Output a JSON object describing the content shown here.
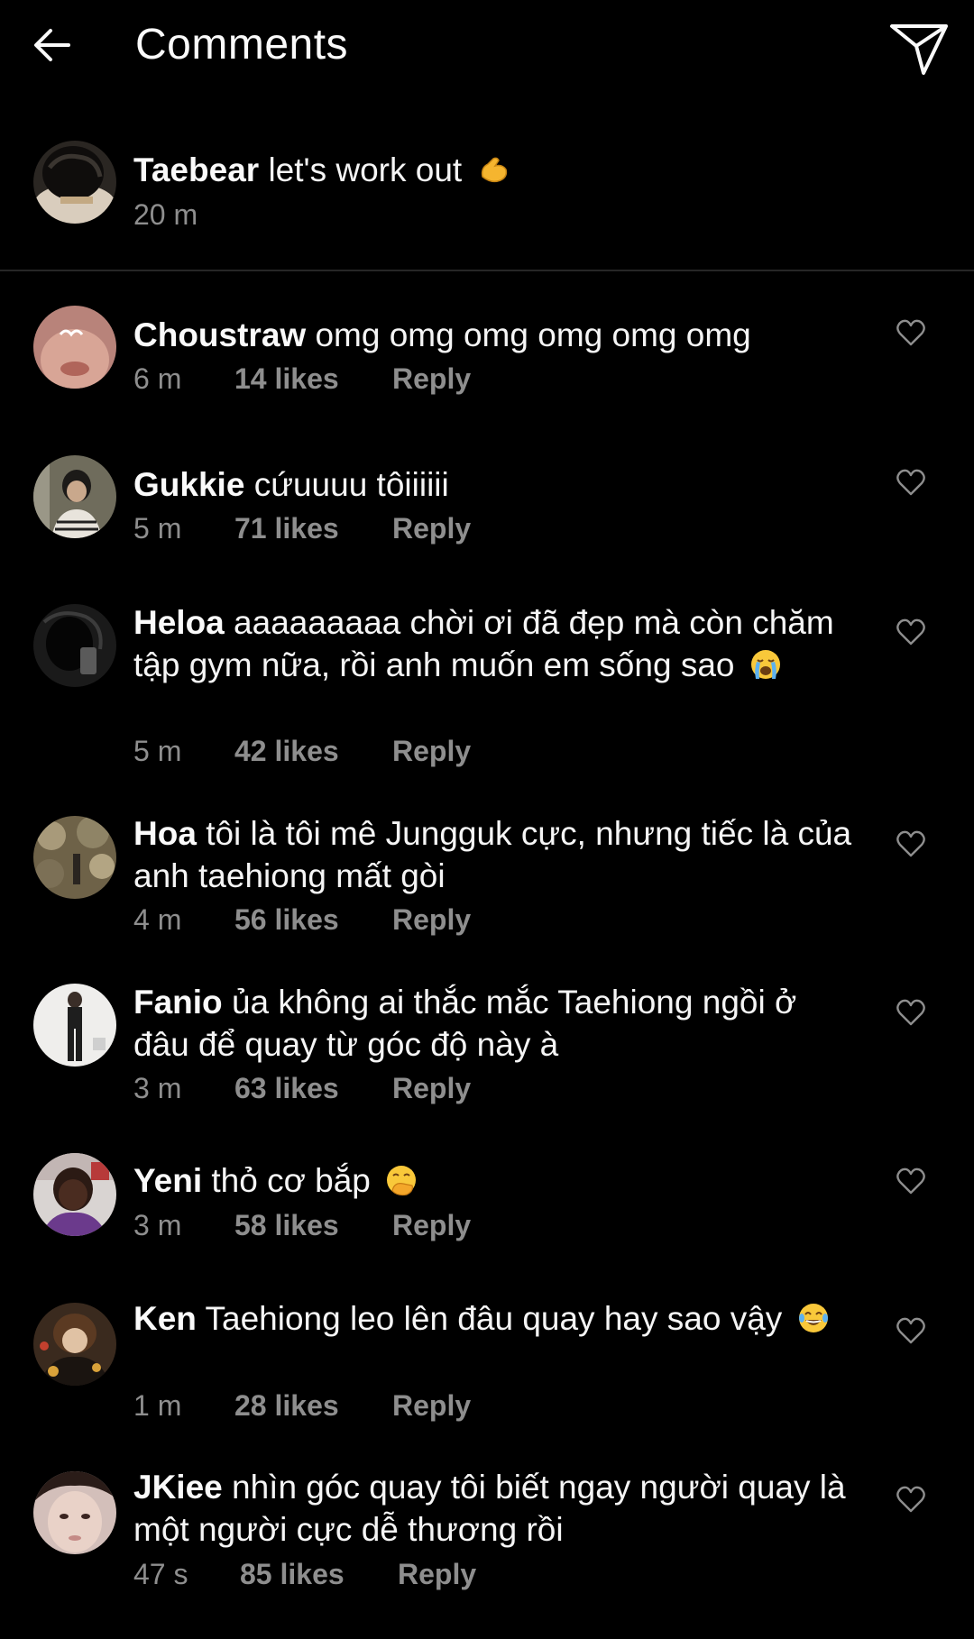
{
  "header": {
    "title": "Comments",
    "back_icon": "back-arrow-icon",
    "send_icon": "paper-plane-icon"
  },
  "caption": {
    "username": "Taebear",
    "text": "let's work out",
    "emoji": "flexed-biceps-emoji",
    "time": "20 m"
  },
  "comments": [
    {
      "username": "Choustraw",
      "text": "omg omg omg omg omg omg",
      "time": "6 m",
      "likes": "14 likes",
      "reply": "Reply"
    },
    {
      "username": "Gukkie",
      "text": "cứuuuu tôiiiiii",
      "time": "5 m",
      "likes": "71 likes",
      "reply": "Reply"
    },
    {
      "username": "Heloa",
      "text": "aaaaaaaaa chời ơi đã đẹp mà còn chăm tập gym nữa, rồi anh muốn em sống sao",
      "emoji": "loudly-crying-face-emoji",
      "time": "5 m",
      "likes": "42 likes",
      "reply": "Reply"
    },
    {
      "username": "Hoa",
      "text": "tôi là tôi mê Jungguk cực, nhưng tiếc là của anh taehiong mất gòi",
      "time": "4 m",
      "likes": "56 likes",
      "reply": "Reply"
    },
    {
      "username": "Fanio",
      "text": "ủa không ai thắc mắc Taehiong ngồi ở đâu để quay từ góc độ này à",
      "time": "3 m",
      "likes": "63 likes",
      "reply": "Reply"
    },
    {
      "username": "Yeni",
      "text": "thỏ cơ bắp",
      "emoji": "face-with-hand-over-mouth-emoji",
      "time": "3 m",
      "likes": "58 likes",
      "reply": "Reply"
    },
    {
      "username": "Ken",
      "text": "Taehiong leo lên đâu quay hay sao vậy",
      "emoji": "face-with-tears-of-joy-emoji",
      "time": "1 m",
      "likes": "28 likes",
      "reply": "Reply"
    },
    {
      "username": "JKiee",
      "text": "nhìn góc quay tôi biết ngay người quay là một người cực dễ thương rồi",
      "time": "47 s",
      "likes": "85 likes",
      "reply": "Reply"
    }
  ],
  "colors": {
    "background": "#000000",
    "text": "#f5f5f5",
    "secondary_text": "#8e8e8e",
    "divider": "#262626"
  }
}
